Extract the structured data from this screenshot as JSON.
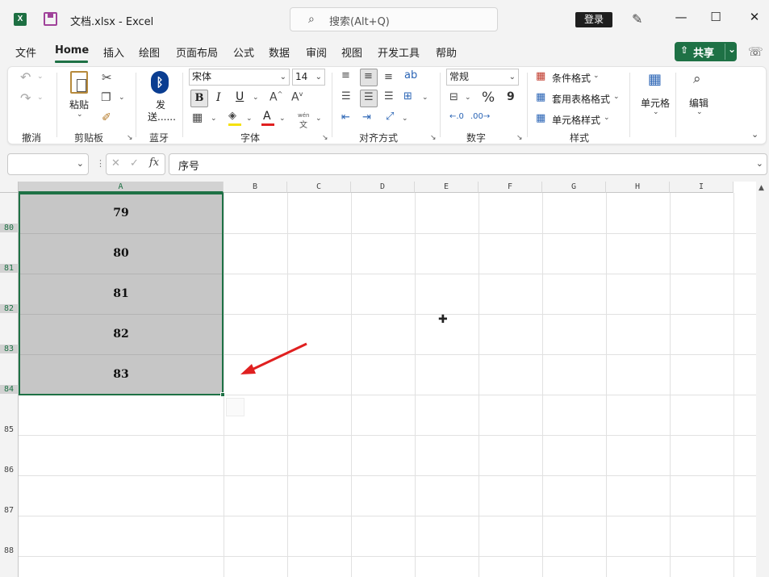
{
  "app": {
    "logo": "X",
    "title": "文档.xlsx  -  Excel",
    "search_placeholder": "搜索(Alt+Q)",
    "login": "登录"
  },
  "menu": {
    "items": [
      "文件",
      "Home",
      "插入",
      "绘图",
      "页面布局",
      "公式",
      "数据",
      "审阅",
      "视图",
      "开发工具",
      "帮助"
    ],
    "active": "Home",
    "share": "共享"
  },
  "ribbon": {
    "groups": {
      "undo": "撤消",
      "clipboard": "剪贴板",
      "bluetooth": "蓝牙",
      "font": "字体",
      "alignment": "对齐方式",
      "number": "数字",
      "styles": "样式"
    },
    "paste_label": "粘贴",
    "send_label_1": "发",
    "send_label_2": "送......",
    "font_name": "宋体",
    "font_size": "14",
    "bold": "B",
    "italic": "I",
    "underline": "U",
    "number_format": "常规",
    "percent": "%",
    "comma": "9",
    "conditional_format": "条件格式",
    "table_format": "套用表格格式",
    "cell_style": "单元格样式",
    "cells_label": "单元格",
    "edit_label": "编辑",
    "wen_pinyin": "wén",
    "wen_char": "文"
  },
  "formula_bar": {
    "name_box": "",
    "fx": "fx",
    "content": "序号"
  },
  "sheet": {
    "columns": [
      "A",
      "B",
      "C",
      "D",
      "E",
      "F",
      "G",
      "H",
      "I"
    ],
    "selected_column": "A",
    "rows": [
      "80",
      "81",
      "82",
      "83",
      "84",
      "85",
      "86",
      "87",
      "88"
    ],
    "selected_rows": [
      "80",
      "81",
      "82",
      "83",
      "84"
    ],
    "values": [
      "79",
      "80",
      "81",
      "82",
      "83"
    ]
  },
  "colors": {
    "accent": "#1e7145",
    "selection_fill": "#c6c6c6",
    "arrow": "#e02020"
  }
}
